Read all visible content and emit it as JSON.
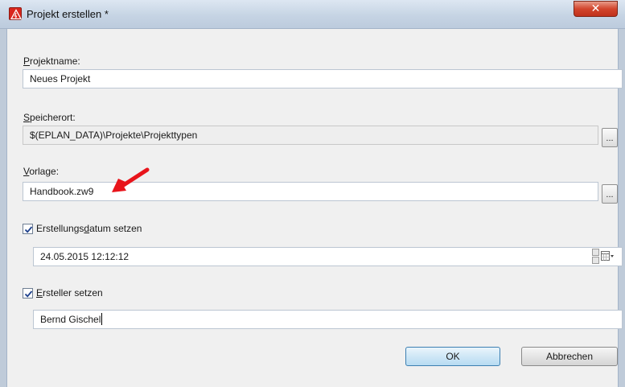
{
  "window": {
    "title": "Projekt erstellen *",
    "close_glyph": "✕"
  },
  "form": {
    "projektname": {
      "label_prefix": "",
      "label_underline": "P",
      "label_rest": "rojektname:",
      "value": "Neues Projekt"
    },
    "speicherort": {
      "label_prefix": "",
      "label_underline": "S",
      "label_rest": "peicherort:",
      "value": "$(EPLAN_DATA)\\Projekte\\Projekttypen",
      "browse": "..."
    },
    "vorlage": {
      "label_prefix": "",
      "label_underline": "V",
      "label_rest": "orlage:",
      "value": "Handbook.zw9",
      "browse": "..."
    },
    "datum": {
      "checked": true,
      "label_prefix": "Erstellungs",
      "label_underline": "d",
      "label_rest": "atum setzen",
      "value": "24.05.2015 12:12:12"
    },
    "ersteller": {
      "checked": true,
      "label_prefix": "",
      "label_underline": "E",
      "label_rest": "rsteller setzen",
      "value": "Bernd Gischel"
    }
  },
  "buttons": {
    "ok": "OK",
    "cancel": "Abbrechen"
  },
  "icons": {
    "app": "eplan-warning-icon",
    "arrow": "red-arrow-annotation",
    "calendar": "calendar-icon"
  },
  "colors": {
    "accent_red": "#d9261c",
    "ok_border": "#3c7fb1",
    "arrow_red": "#e8141b"
  }
}
